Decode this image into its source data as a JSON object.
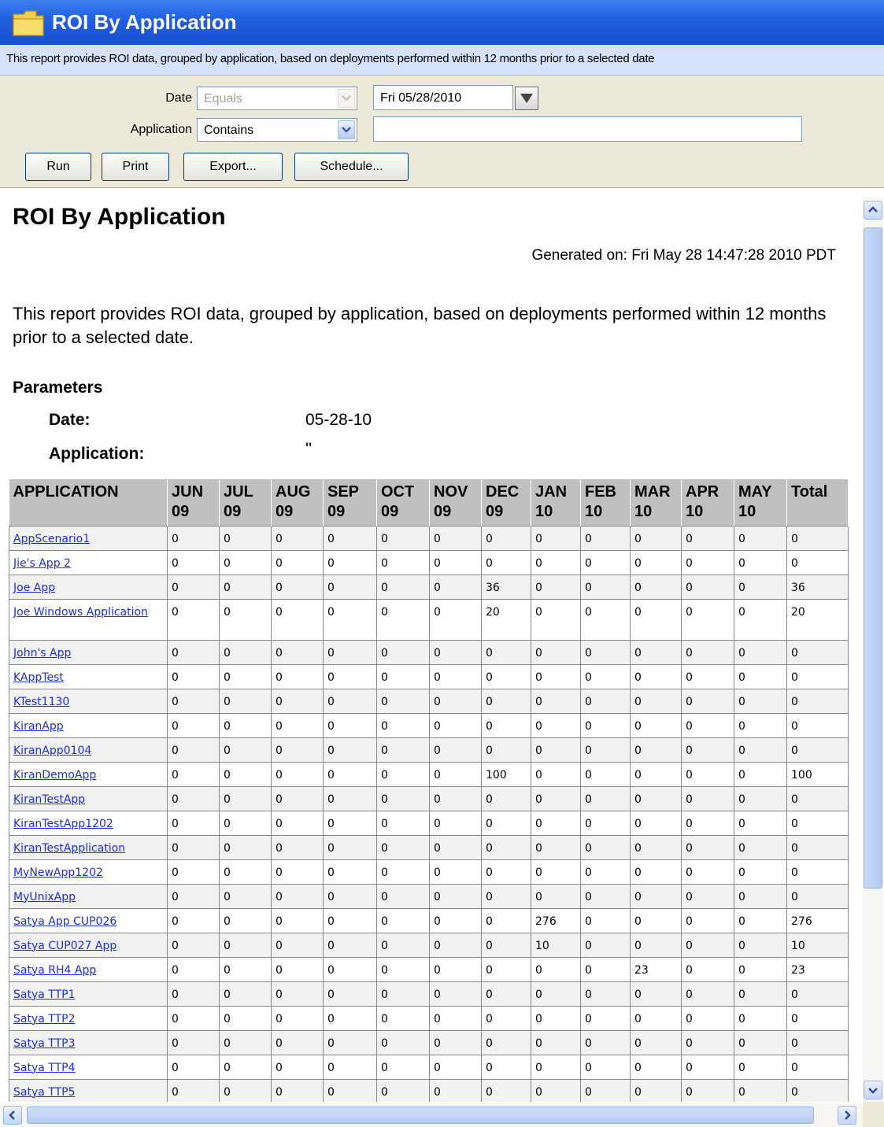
{
  "window": {
    "title": "ROI By Application"
  },
  "description": "This report provides ROI data, grouped by application, based on deployments performed within 12 months prior to a selected date",
  "filters": {
    "date_label": "Date",
    "date_operator": "Equals",
    "date_value": "Fri 05/28/2010",
    "app_label": "Application",
    "app_operator": "Contains",
    "app_value": ""
  },
  "buttons": {
    "run": "Run",
    "print": "Print",
    "export": "Export...",
    "schedule": "Schedule..."
  },
  "report": {
    "title": "ROI By Application",
    "generated": "Generated on: Fri May 28 14:47:28 2010 PDT",
    "intro": "This report provides ROI data, grouped by application, based on deployments performed within 12 months prior to a selected date.",
    "params_heading": "Parameters",
    "params": [
      {
        "label": "Date:",
        "value": "05-28-10"
      },
      {
        "label": "Application:",
        "value": "''"
      }
    ]
  },
  "table": {
    "headers": [
      "APPLICATION",
      "JUN 09",
      "JUL 09",
      "AUG 09",
      "SEP 09",
      "OCT 09",
      "NOV 09",
      "DEC 09",
      "JAN 10",
      "FEB 10",
      "MAR 10",
      "APR 10",
      "MAY 10",
      "Total"
    ],
    "rows": [
      [
        "AppScenario1",
        "0",
        "0",
        "0",
        "0",
        "0",
        "0",
        "0",
        "0",
        "0",
        "0",
        "0",
        "0",
        "0"
      ],
      [
        "Jie's App 2",
        "0",
        "0",
        "0",
        "0",
        "0",
        "0",
        "0",
        "0",
        "0",
        "0",
        "0",
        "0",
        "0"
      ],
      [
        "Joe App",
        "0",
        "0",
        "0",
        "0",
        "0",
        "0",
        "36",
        "0",
        "0",
        "0",
        "0",
        "0",
        "36"
      ],
      [
        "Joe Windows Application",
        "0",
        "0",
        "0",
        "0",
        "0",
        "0",
        "20",
        "0",
        "0",
        "0",
        "0",
        "0",
        "20"
      ],
      [
        "John's App",
        "0",
        "0",
        "0",
        "0",
        "0",
        "0",
        "0",
        "0",
        "0",
        "0",
        "0",
        "0",
        "0"
      ],
      [
        "KAppTest",
        "0",
        "0",
        "0",
        "0",
        "0",
        "0",
        "0",
        "0",
        "0",
        "0",
        "0",
        "0",
        "0"
      ],
      [
        "KTest1130",
        "0",
        "0",
        "0",
        "0",
        "0",
        "0",
        "0",
        "0",
        "0",
        "0",
        "0",
        "0",
        "0"
      ],
      [
        "KiranApp",
        "0",
        "0",
        "0",
        "0",
        "0",
        "0",
        "0",
        "0",
        "0",
        "0",
        "0",
        "0",
        "0"
      ],
      [
        "KiranApp0104",
        "0",
        "0",
        "0",
        "0",
        "0",
        "0",
        "0",
        "0",
        "0",
        "0",
        "0",
        "0",
        "0"
      ],
      [
        "KiranDemoApp",
        "0",
        "0",
        "0",
        "0",
        "0",
        "0",
        "100",
        "0",
        "0",
        "0",
        "0",
        "0",
        "100"
      ],
      [
        "KiranTestApp",
        "0",
        "0",
        "0",
        "0",
        "0",
        "0",
        "0",
        "0",
        "0",
        "0",
        "0",
        "0",
        "0"
      ],
      [
        "KiranTestApp1202",
        "0",
        "0",
        "0",
        "0",
        "0",
        "0",
        "0",
        "0",
        "0",
        "0",
        "0",
        "0",
        "0"
      ],
      [
        "KiranTestApplication",
        "0",
        "0",
        "0",
        "0",
        "0",
        "0",
        "0",
        "0",
        "0",
        "0",
        "0",
        "0",
        "0"
      ],
      [
        "MyNewApp1202",
        "0",
        "0",
        "0",
        "0",
        "0",
        "0",
        "0",
        "0",
        "0",
        "0",
        "0",
        "0",
        "0"
      ],
      [
        "MyUnixApp",
        "0",
        "0",
        "0",
        "0",
        "0",
        "0",
        "0",
        "0",
        "0",
        "0",
        "0",
        "0",
        "0"
      ],
      [
        "Satya App CUP026",
        "0",
        "0",
        "0",
        "0",
        "0",
        "0",
        "0",
        "276",
        "0",
        "0",
        "0",
        "0",
        "276"
      ],
      [
        "Satya CUP027 App",
        "0",
        "0",
        "0",
        "0",
        "0",
        "0",
        "0",
        "10",
        "0",
        "0",
        "0",
        "0",
        "10"
      ],
      [
        "Satya RH4 App",
        "0",
        "0",
        "0",
        "0",
        "0",
        "0",
        "0",
        "0",
        "0",
        "23",
        "0",
        "0",
        "23"
      ],
      [
        "Satya TTP1",
        "0",
        "0",
        "0",
        "0",
        "0",
        "0",
        "0",
        "0",
        "0",
        "0",
        "0",
        "0",
        "0"
      ],
      [
        "Satya TTP2",
        "0",
        "0",
        "0",
        "0",
        "0",
        "0",
        "0",
        "0",
        "0",
        "0",
        "0",
        "0",
        "0"
      ],
      [
        "Satya TTP3",
        "0",
        "0",
        "0",
        "0",
        "0",
        "0",
        "0",
        "0",
        "0",
        "0",
        "0",
        "0",
        "0"
      ],
      [
        "Satya TTP4",
        "0",
        "0",
        "0",
        "0",
        "0",
        "0",
        "0",
        "0",
        "0",
        "0",
        "0",
        "0",
        "0"
      ],
      [
        "Satya TTP5",
        "0",
        "0",
        "0",
        "0",
        "0",
        "0",
        "0",
        "0",
        "0",
        "0",
        "0",
        "0",
        "0"
      ]
    ]
  }
}
